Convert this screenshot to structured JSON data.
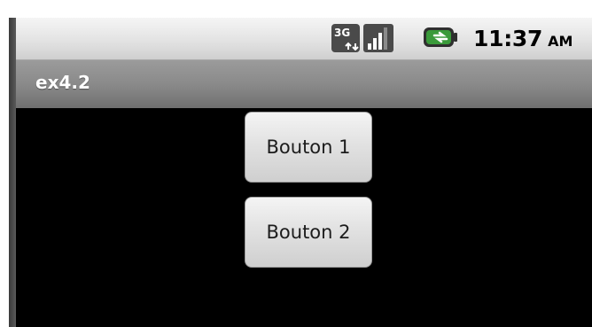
{
  "status_bar": {
    "time": "11:37",
    "ampm": "AM",
    "network_badge": "3G",
    "icons": [
      "network-3g-icon",
      "signal-strength-icon",
      "battery-charging-icon"
    ],
    "colors": {
      "battery_green": "#3a9a3a",
      "signal_bars": "#2b2b2b"
    }
  },
  "app": {
    "title": "ex4.2"
  },
  "buttons": [
    {
      "label": "Bouton 1"
    },
    {
      "label": "Bouton 2"
    }
  ]
}
